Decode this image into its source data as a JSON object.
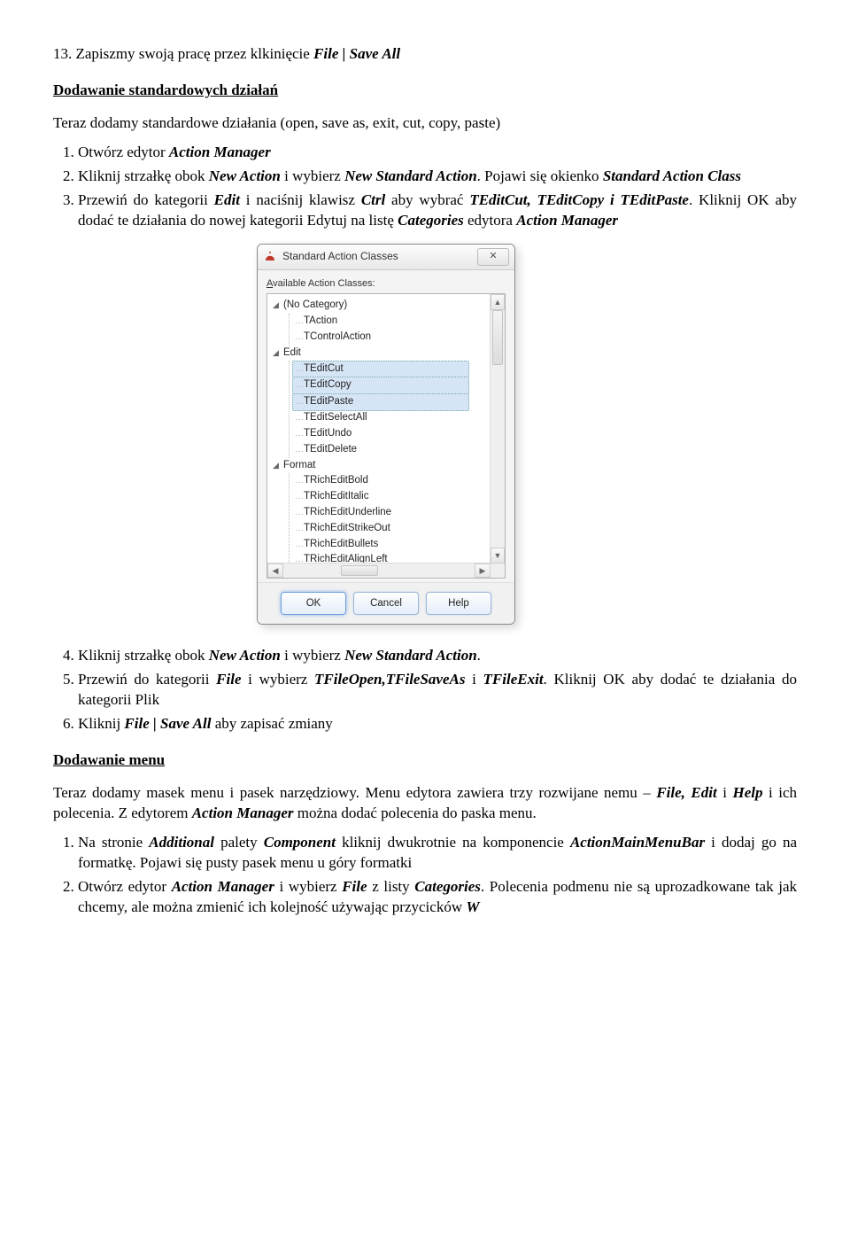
{
  "instr_top": "13. Zapiszmy swoją pracę przez klkinięcie File | Save All",
  "section1_title": "Dodawanie standardowych działań",
  "section1_intro": "Teraz dodamy standardowe działania (open, save as, exit, cut, copy, paste)",
  "steps1": {
    "s1": "Otwórz edytor Action Manager",
    "s2a": "Kliknij strzałkę obok New Action  i wybierz New Standard Action. Pojawi się okienko ",
    "s2b": "Standard Action Class",
    "s3a": "Przewiń do kategorii Edit  i naciśnij klawisz Ctrl  aby wybrać TEditCut, TEditCopy i TEditPaste. Kliknij OK aby dodać te działania do nowej kategorii Edytuj na listę ",
    "s3b": "Categories",
    "s3c": " edytora Action Manager"
  },
  "dialog": {
    "title": "Standard Action Classes",
    "available_label": "Available Action Classes:",
    "groups": [
      {
        "name": "(No Category)",
        "items": [
          "TAction",
          "TControlAction"
        ]
      },
      {
        "name": "Edit",
        "items": [
          "TEditCut",
          "TEditCopy",
          "TEditPaste",
          "TEditSelectAll",
          "TEditUndo",
          "TEditDelete"
        ],
        "selected": [
          "TEditCut",
          "TEditCopy",
          "TEditPaste"
        ]
      },
      {
        "name": "Format",
        "items": [
          "TRichEditBold",
          "TRichEditItalic",
          "TRichEditUnderline",
          "TRichEditStrikeOut",
          "TRichEditBullets",
          "TRichEditAlignLeft"
        ]
      }
    ],
    "buttons": {
      "ok": "OK",
      "cancel": "Cancel",
      "help": "Help"
    }
  },
  "steps2": {
    "s4": "Kliknij strzałkę obok New Action  i wybierz New Standard Action.",
    "s5a": "Przewiń do kategorii File i wybierz  TFileOpen,TFileSaveAs i TFileExit. Kliknij OK aby dodać te działania do kategorii Plik",
    "s6": "Kliknij File | Save All aby zapisać zmiany"
  },
  "section2_title": "Dodawanie menu ",
  "section2_para": "Teraz dodamy masek menu i pasek narzędziowy. Menu edytora zawiera trzy rozwijane nemu – File, Edit i Help  i ich polecenia. Z edytorem Action Manager  można dodać polecenia do paska menu.",
  "steps3": {
    "s1": "Na stronie Additional   palety Component kliknij dwukrotnie na komponencie ActionMainMenuBar  i dodaj go na formatkę. Pojawi  się pusty pasek menu u góry formatki",
    "s2": "Otwórz edytor Action Manager i wybierz File z listy Categories. Polecenia podmenu  nie są uprozadkowane tak jak chcemy, ale można zmienić ich kolejność używając przycicków W"
  }
}
